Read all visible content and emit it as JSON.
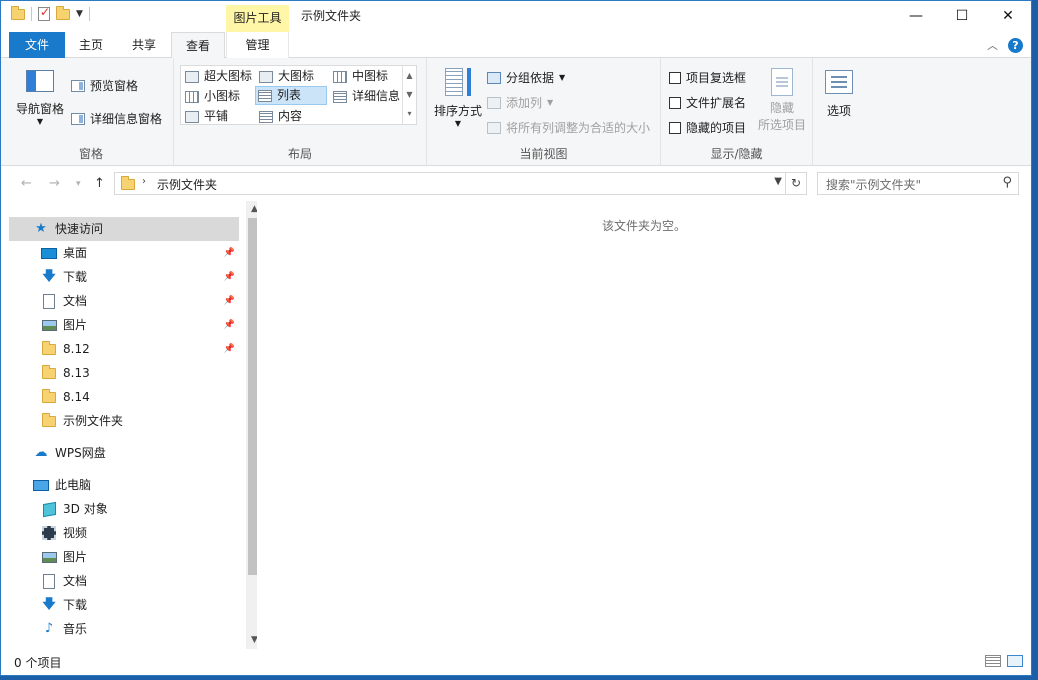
{
  "titlebar": {
    "context_tab_title": "图片工具",
    "window_title": "示例文件夹",
    "minimize": "—",
    "maximize": "☐",
    "close": "✕"
  },
  "tabs": {
    "file": "文件",
    "home": "主页",
    "share": "共享",
    "view": "查看",
    "manage": "管理"
  },
  "ribbon": {
    "panes": {
      "label": "窗格",
      "nav_pane": "导航窗格",
      "preview_pane": "预览窗格",
      "details_pane": "详细信息窗格"
    },
    "layout": {
      "label": "布局",
      "items": {
        "extra_large": "超大图标",
        "large": "大图标",
        "medium": "中图标",
        "small": "小图标",
        "list": "列表",
        "details": "详细信息",
        "tiles": "平铺",
        "content": "内容"
      },
      "selected": "列表"
    },
    "current_view": {
      "label": "当前视图",
      "sort_by": "排序方式",
      "group_by": "分组依据",
      "add_columns": "添加列",
      "size_all_columns": "将所有列调整为合适的大小"
    },
    "show_hide": {
      "label": "显示/隐藏",
      "item_checkboxes": "项目复选框",
      "file_extensions": "文件扩展名",
      "hidden_items": "隐藏的项目",
      "hide_selected_line1": "隐藏",
      "hide_selected_line2": "所选项目"
    },
    "options": {
      "label": "选项"
    }
  },
  "address": {
    "crumb": "示例文件夹",
    "search_placeholder": "搜索\"示例文件夹\""
  },
  "nav": {
    "quick_access": "快速访问",
    "qa_items": [
      "桌面",
      "下载",
      "文档",
      "图片",
      "8.12",
      "8.13",
      "8.14",
      "示例文件夹"
    ],
    "wps": "WPS网盘",
    "this_pc": "此电脑",
    "pc_items": [
      "3D 对象",
      "视频",
      "图片",
      "文档",
      "下载",
      "音乐"
    ]
  },
  "content": {
    "empty_message": "该文件夹为空。"
  },
  "status": {
    "item_count": "0 个项目"
  }
}
